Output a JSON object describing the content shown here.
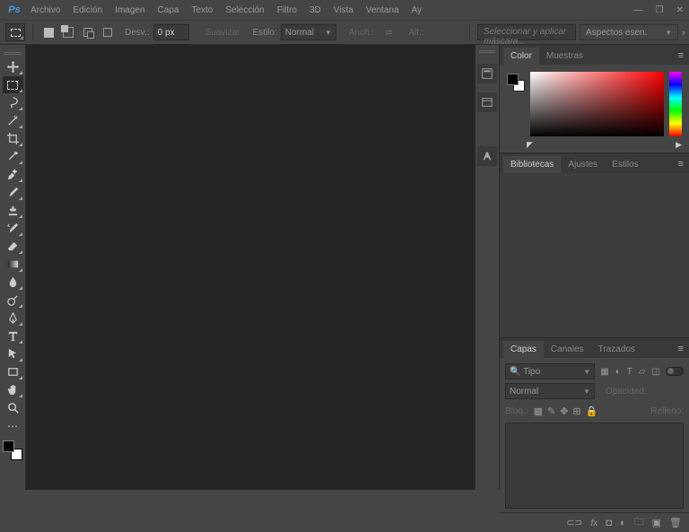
{
  "app": {
    "logo": "Ps"
  },
  "menu": [
    "Archivo",
    "Edición",
    "Imagen",
    "Capa",
    "Texto",
    "Selección",
    "Filtro",
    "3D",
    "Vista",
    "Ventana",
    "Ay"
  ],
  "optionsbar": {
    "desv_label": "Desv.:",
    "desv_value": "0 px",
    "suavizar": "Suavizar",
    "estilo_label": "Estilo:",
    "estilo_value": "Normal",
    "anch_label": "Anch.:",
    "alt_label": "Alt.:",
    "search_placeholder": "Seleccionar y aplicar máscara...",
    "workspace": "Aspectos esen."
  },
  "panels": {
    "color": {
      "tabs": [
        "Color",
        "Muestras"
      ],
      "active": 0
    },
    "libs": {
      "tabs": [
        "Bibliotecas",
        "Ajustes",
        "Estilos"
      ],
      "active": 0
    },
    "layers": {
      "tabs": [
        "Capas",
        "Canales",
        "Trazados"
      ],
      "active": 0,
      "filter_label": "Tipo",
      "blend": "Normal",
      "opacity_label": "Opacidad:",
      "lock_label": "Bloq.:",
      "fill_label": "Relleno:"
    }
  },
  "icons": {
    "move": "move",
    "marquee": "marquee",
    "lasso": "lasso",
    "wand": "wand",
    "crop": "crop",
    "eyedrop": "eyedrop",
    "heal": "heal",
    "brush": "brush",
    "stamp": "stamp",
    "history": "history",
    "eraser": "eraser",
    "gradient": "gradient",
    "blur": "blur",
    "dodge": "dodge",
    "pen": "pen",
    "type": "type",
    "path": "path",
    "shape": "shape",
    "hand": "hand",
    "zoom": "zoom",
    "more": "more"
  }
}
